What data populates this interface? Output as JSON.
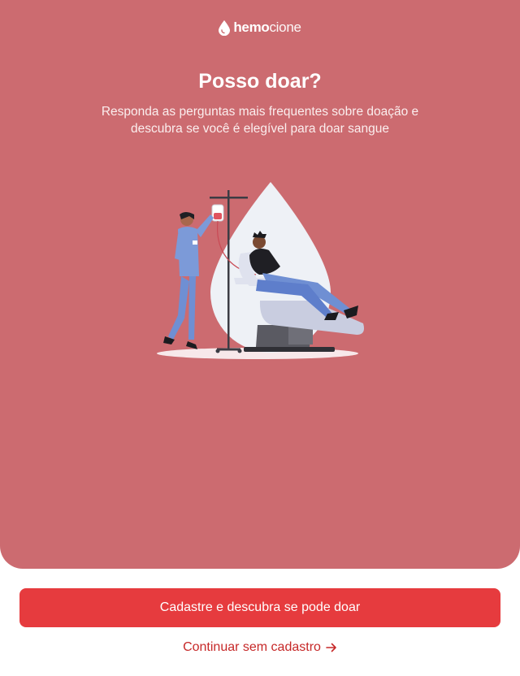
{
  "brand": {
    "logo_bold": "hemo",
    "logo_light": "cione",
    "icon": "blood-drop-icon"
  },
  "hero": {
    "title": "Posso doar?",
    "subtitle": "Responda as perguntas mais frequentes sobre doação e descubra se você é elegível para doar sangue",
    "illustration": "nurse-and-blood-donor-illustration"
  },
  "actions": {
    "primary_label": "Cadastre e descubra se pode doar",
    "secondary_label": "Continuar sem cadastro",
    "secondary_icon": "arrow-right-icon"
  },
  "colors": {
    "hero_background": "#cc6b70",
    "primary_button": "#e63b3e",
    "link_text": "#c62828"
  }
}
